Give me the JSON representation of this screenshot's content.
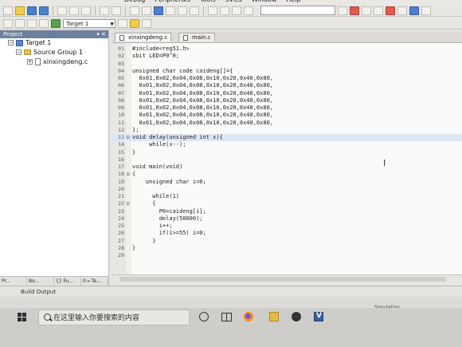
{
  "menubar": {
    "items": [
      "Debug",
      "Peripherals",
      "Tools",
      "SVCS",
      "Window",
      "Help"
    ]
  },
  "toolbar": {
    "target_select": "Target 1"
  },
  "project_panel": {
    "title": "Project",
    "controls": "▾ ✕",
    "tree": {
      "target": "Target 1",
      "group": "Source Group 1",
      "file": "xinxingdeng.c"
    },
    "tabs": [
      "Pr...",
      "Bo...",
      "{} Fu...",
      "0→ Te..."
    ]
  },
  "editor": {
    "tabs": [
      {
        "label": "xinxingdeng.c",
        "active": true
      },
      {
        "label": "main.c",
        "active": false
      }
    ],
    "lines": [
      {
        "n": "01",
        "fold": "",
        "text": "#include<reg51.h>"
      },
      {
        "n": "02",
        "fold": "",
        "text": "sbit LED=P0^0;"
      },
      {
        "n": "03",
        "fold": "",
        "text": ""
      },
      {
        "n": "04",
        "fold": "",
        "text": "unsigned char code caideng[]={"
      },
      {
        "n": "05",
        "fold": "",
        "text": "  0x01,0x02,0x04,0x08,0x10,0x20,0x40,0x80,"
      },
      {
        "n": "06",
        "fold": "",
        "text": "  0x01,0x02,0x04,0x08,0x10,0x20,0x40,0x80,"
      },
      {
        "n": "07",
        "fold": "",
        "text": "  0x01,0x02,0x04,0x08,0x10,0x20,0x40,0x80,"
      },
      {
        "n": "08",
        "fold": "",
        "text": "  0x01,0x02,0x04,0x08,0x10,0x20,0x40,0x80,"
      },
      {
        "n": "09",
        "fold": "",
        "text": "  0x01,0x02,0x04,0x08,0x10,0x20,0x40,0x80,"
      },
      {
        "n": "10",
        "fold": "",
        "text": "  0x01,0x02,0x04,0x08,0x10,0x20,0x40,0x80,"
      },
      {
        "n": "11",
        "fold": "",
        "text": "  0x01,0x02,0x04,0x08,0x10,0x20,0x40,0x80,"
      },
      {
        "n": "12",
        "fold": "",
        "text": "};"
      },
      {
        "n": "13",
        "fold": "⊟",
        "text": "void delay(unsigned int x){"
      },
      {
        "n": "14",
        "fold": "",
        "text": "     while(x--);"
      },
      {
        "n": "15",
        "fold": "",
        "text": "}"
      },
      {
        "n": "16",
        "fold": "",
        "text": ""
      },
      {
        "n": "17",
        "fold": "",
        "text": "void main(void)"
      },
      {
        "n": "18",
        "fold": "⊟",
        "text": "{"
      },
      {
        "n": "19",
        "fold": "",
        "text": "    unsigned char i=0;"
      },
      {
        "n": "20",
        "fold": "",
        "text": ""
      },
      {
        "n": "21",
        "fold": "",
        "text": "      while(1)"
      },
      {
        "n": "22",
        "fold": "⊟",
        "text": "      {"
      },
      {
        "n": "23",
        "fold": "",
        "text": "        P0=caideng[i];"
      },
      {
        "n": "24",
        "fold": "",
        "text": "        delay(50000);"
      },
      {
        "n": "25",
        "fold": "",
        "text": "        i++;"
      },
      {
        "n": "26",
        "fold": "",
        "text": "        if(i>=55) i=0;"
      },
      {
        "n": "27",
        "fold": "",
        "text": "      }"
      },
      {
        "n": "28",
        "fold": "",
        "text": "}"
      },
      {
        "n": "29",
        "fold": "",
        "text": ""
      }
    ],
    "cursor_line": "13",
    "ibeam": "I"
  },
  "build_output": {
    "title": "Build Output"
  },
  "status": {
    "mode": "Simulation"
  },
  "taskbar": {
    "search_placeholder": "在这里输入你要搜索的内容"
  }
}
